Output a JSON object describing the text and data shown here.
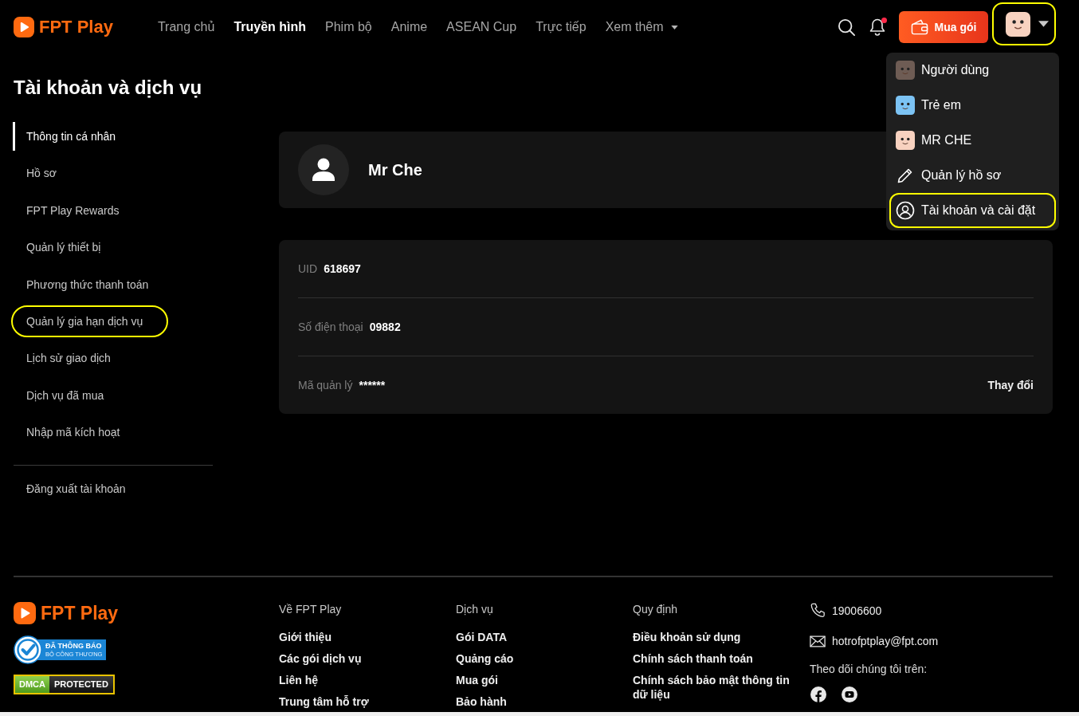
{
  "header": {
    "logo": "FPT Play",
    "nav": [
      {
        "label": "Trang chủ",
        "selected": false
      },
      {
        "label": "Truyền hình",
        "selected": true
      },
      {
        "label": "Phim bộ",
        "selected": false
      },
      {
        "label": "Anime",
        "selected": false
      },
      {
        "label": "ASEAN Cup",
        "selected": false
      },
      {
        "label": "Trực tiếp",
        "selected": false
      },
      {
        "label": "Xem thêm",
        "selected": false,
        "has_menu": true
      }
    ],
    "notifications_unread": true,
    "buy_button": "Mua gói",
    "account_button": {
      "expanded": true,
      "highlighted": true
    }
  },
  "account_menu": {
    "items": [
      {
        "kind": "profile",
        "label": "Người dùng",
        "color": "#6e5c54",
        "highlighted": false
      },
      {
        "kind": "profile",
        "label": "Trẻ em",
        "color": "#7cc3f4",
        "highlighted": false
      },
      {
        "kind": "profile",
        "label": "MR CHE",
        "color": "#f8d2c0",
        "highlighted": false
      },
      {
        "kind": "manage",
        "label": "Quản lý hồ sơ",
        "highlighted": false
      },
      {
        "kind": "account",
        "label": "Tài khoản và cài đặt",
        "highlighted": true
      }
    ]
  },
  "page_title": "Tài khoản và dịch vụ",
  "sidebar": {
    "items": [
      {
        "label": "Thông tin cá nhân",
        "selected": true,
        "highlighted": false
      },
      {
        "label": "Hồ sơ",
        "selected": false,
        "highlighted": false
      },
      {
        "label": "FPT Play Rewards",
        "selected": false,
        "highlighted": false
      },
      {
        "label": "Quản lý thiết bị",
        "selected": false,
        "highlighted": false
      },
      {
        "label": "Phương thức thanh toán",
        "selected": false,
        "highlighted": false
      },
      {
        "label": "Quản lý gia hạn dịch vụ",
        "selected": false,
        "highlighted": true
      },
      {
        "label": "Lịch sử giao dịch",
        "selected": false,
        "highlighted": false
      },
      {
        "label": "Dịch vụ đã mua",
        "selected": false,
        "highlighted": false
      },
      {
        "label": "Nhập mã kích hoạt",
        "selected": false,
        "highlighted": false
      }
    ],
    "logout": "Đăng xuất tài khoản"
  },
  "profile": {
    "name": "Mr Che"
  },
  "account_info": {
    "rows": [
      {
        "label": "UID",
        "value": "618697"
      },
      {
        "label": "Số điện thoại",
        "value": "09882"
      },
      {
        "label": "Mã quản lý",
        "value": "******",
        "action": "Thay đổi"
      }
    ]
  },
  "footer": {
    "logo": "FPT Play",
    "notice_badge": {
      "title": "ĐÃ THÔNG BÁO",
      "subtitle": "BỘ CÔNG THƯƠNG"
    },
    "dmca_badge": {
      "left": "DMCA",
      "right": "PROTECTED"
    },
    "columns": [
      {
        "heading": "Về FPT Play",
        "links": [
          "Giới thiệu",
          "Các gói dịch vụ",
          "Liên hệ",
          "Trung tâm hỗ trợ"
        ]
      },
      {
        "heading": "Dịch vụ",
        "links": [
          "Gói DATA",
          "Quảng cáo",
          "Mua gói",
          "Bảo hành"
        ]
      },
      {
        "heading": "Quy định",
        "links": [
          "Điều khoản sử dụng",
          "Chính sách thanh toán",
          "Chính sách bảo mật thông tin dữ liệu"
        ]
      }
    ],
    "contact": {
      "phone": "19006600",
      "email": "hotrofptplay@fpt.com",
      "follow_label": "Theo dõi chúng tôi trên:",
      "socials": [
        {
          "kind": "facebook"
        },
        {
          "kind": "video"
        }
      ]
    }
  }
}
